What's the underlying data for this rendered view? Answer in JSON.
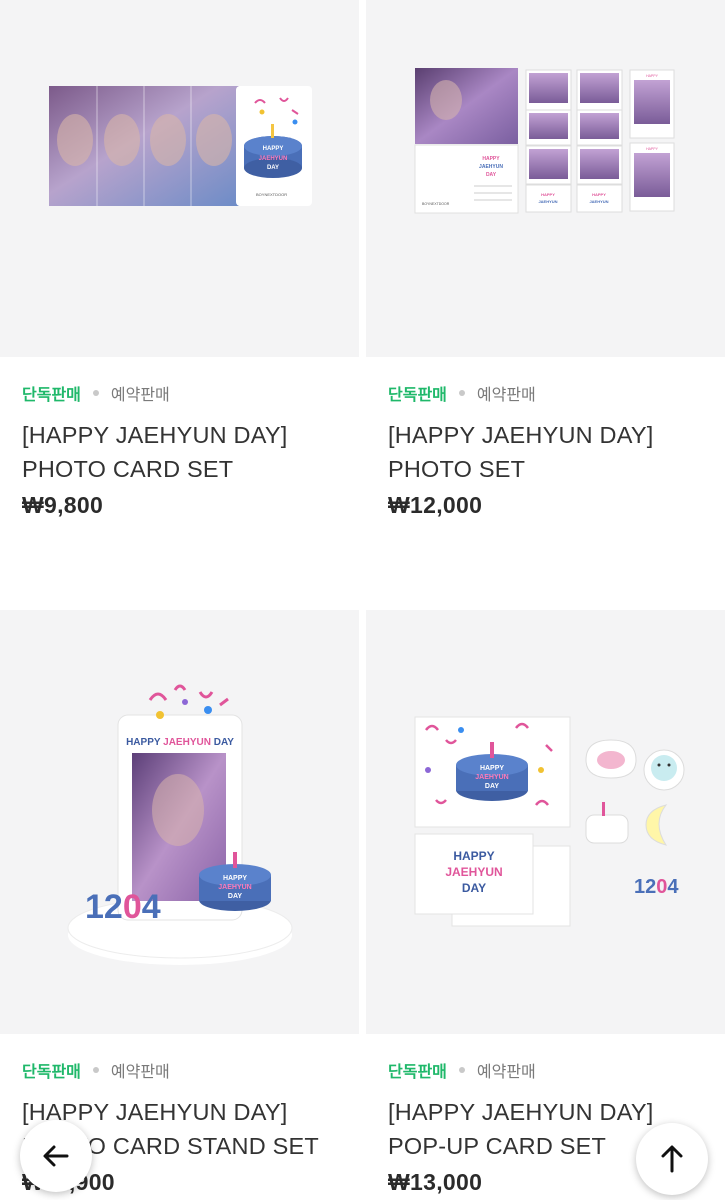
{
  "products": [
    {
      "tag_exclusive": "단독판매",
      "tag_preorder": "예약판매",
      "title": "[HAPPY JAEHYUN DAY] PHOTO CARD SET",
      "price": "₩9,800"
    },
    {
      "tag_exclusive": "단독판매",
      "tag_preorder": "예약판매",
      "title": "[HAPPY JAEHYUN DAY] PHOTO SET",
      "price": "₩12,000"
    },
    {
      "tag_exclusive": "단독판매",
      "tag_preorder": "예약판매",
      "title": "[HAPPY JAEHYUN DAY] PHOTO CARD STAND SET",
      "price": "₩11,900"
    },
    {
      "tag_exclusive": "단독판매",
      "tag_preorder": "예약판매",
      "title": "[HAPPY JAEHYUN DAY] POP-UP CARD SET",
      "price": "₩13,000"
    }
  ],
  "art": {
    "happy_day_text": "HAPPY JAEHYUN DAY",
    "number_1204": "1204",
    "brand": "BOYNEXTDOOR"
  },
  "icons": {
    "back": "arrow-left-icon",
    "top": "arrow-up-icon"
  }
}
